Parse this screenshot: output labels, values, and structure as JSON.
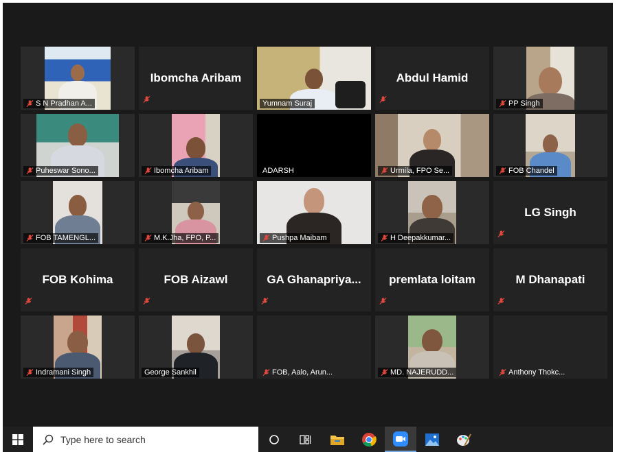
{
  "participants": [
    {
      "name": "S N Pradhan A...",
      "type": "video"
    },
    {
      "name": "Ibomcha Aribam",
      "type": "name"
    },
    {
      "name": "Yumnam Suraj",
      "type": "video",
      "active": true
    },
    {
      "name": "Abdul Hamid",
      "type": "name"
    },
    {
      "name": "PP Singh",
      "type": "video"
    },
    {
      "name": "Puheswar Sono...",
      "type": "video"
    },
    {
      "name": "Ibomcha Aribam",
      "type": "video"
    },
    {
      "name": "ADARSH",
      "type": "black"
    },
    {
      "name": "Urmila, FPO Se...",
      "type": "video"
    },
    {
      "name": "FOB Chandel",
      "type": "video"
    },
    {
      "name": "FOB TAMENGL...",
      "type": "video"
    },
    {
      "name": "M.K.Jha, FPO, P...",
      "type": "video"
    },
    {
      "name": "Pushpa Maibam",
      "type": "video"
    },
    {
      "name": "H Deepakkumar...",
      "type": "video"
    },
    {
      "name": "LG Singh",
      "type": "name"
    },
    {
      "name": "FOB Kohima",
      "type": "name"
    },
    {
      "name": "FOB Aizawl",
      "type": "name"
    },
    {
      "name": "GA  Ghanapriya...",
      "type": "name"
    },
    {
      "name": "premlata loitam",
      "type": "name"
    },
    {
      "name": "M Dhanapati",
      "type": "name"
    },
    {
      "name": "Indramani Singh",
      "type": "video"
    },
    {
      "name": "George Sankhil",
      "type": "video"
    },
    {
      "name": "FOB, Aalo, Arun...",
      "type": "empty"
    },
    {
      "name": "MD. NAJERUDD...",
      "type": "video"
    },
    {
      "name": "Anthony Thokc...",
      "type": "empty"
    }
  ],
  "taskbar": {
    "search_placeholder": "Type here to search",
    "icons": [
      "windows-start-icon",
      "search-icon",
      "cortana-icon",
      "task-view-icon",
      "file-explorer-icon",
      "chrome-icon",
      "zoom-icon",
      "photos-icon",
      "paint-icon"
    ]
  },
  "colors": {
    "meeting_bg": "#1a1a1a",
    "tile_bg": "#232323",
    "active_border": "#c6e54a",
    "muted_mic": "#e0483e",
    "taskbar_bg": "#1f1f1f"
  }
}
